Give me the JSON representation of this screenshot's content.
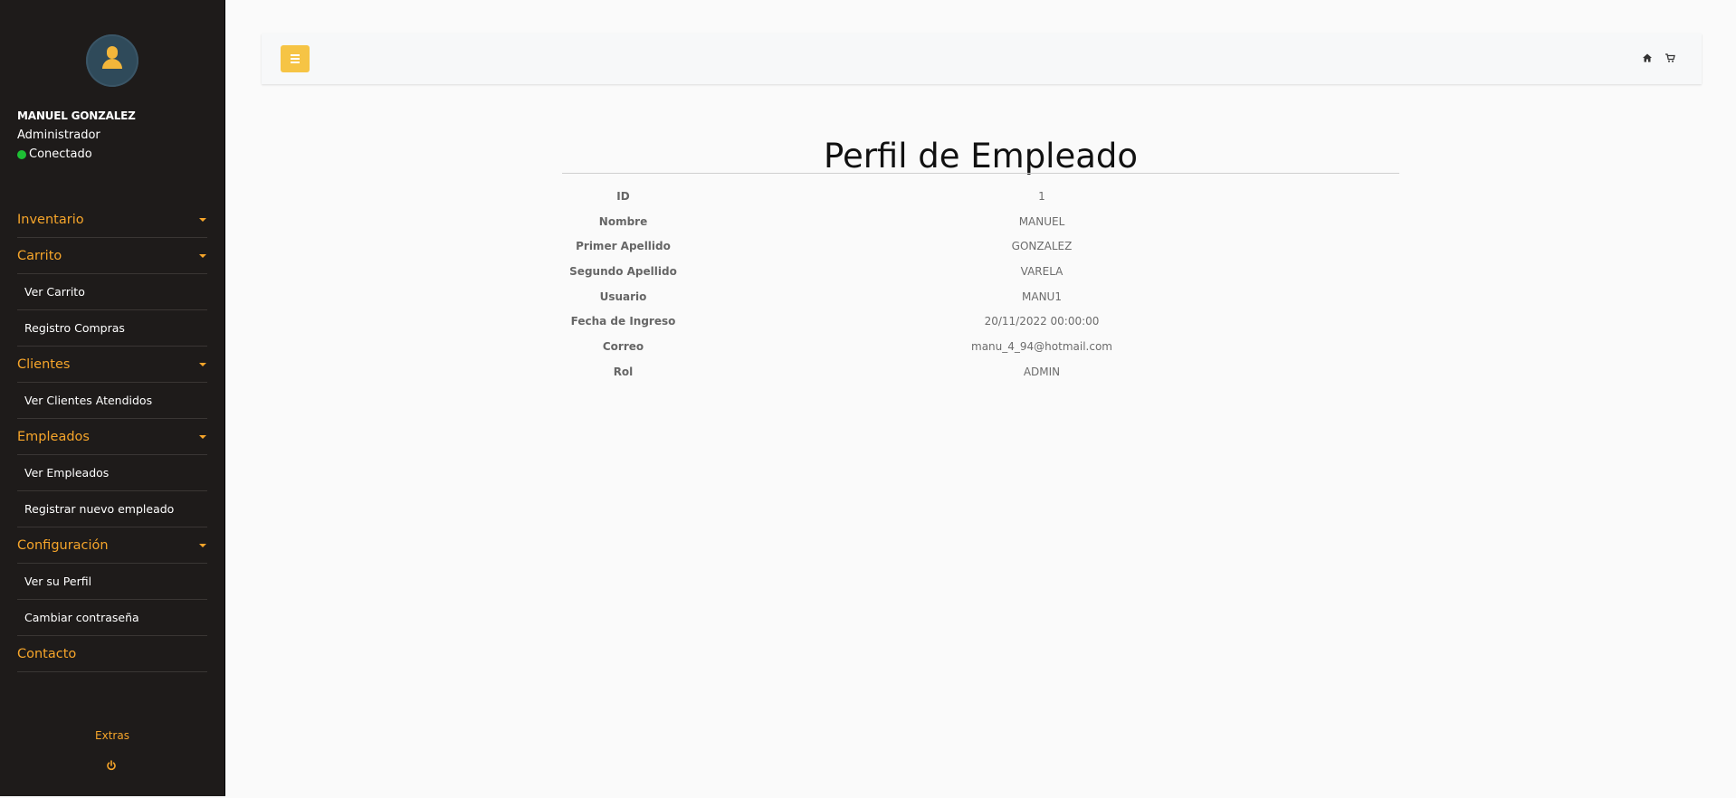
{
  "user": {
    "name": "MANUEL GONZALEZ",
    "role": "Administrador",
    "status": "Conectado"
  },
  "nav": {
    "inventario": "Inventario",
    "carrito": "Carrito",
    "ver_carrito": "Ver Carrito",
    "registro_compras": "Registro Compras",
    "clientes": "Clientes",
    "ver_clientes_atendidos": "Ver Clientes Atendidos",
    "empleados": "Empleados",
    "ver_empleados": "Ver Empleados",
    "registrar_nuevo_empleado": "Registrar nuevo empleado",
    "configuracion": "Configuración",
    "ver_su_perfil": "Ver su Perfil",
    "cambiar_contrasena": "Cambiar contraseña",
    "contacto": "Contacto"
  },
  "footer": {
    "extras": "Extras",
    "power_icon": "power-icon"
  },
  "topbar": {
    "menu_icon": "hamburger-icon",
    "home_icon": "home-icon",
    "cart_icon": "cart-icon"
  },
  "page": {
    "title": "Perfil de Empleado"
  },
  "profile": {
    "rows": [
      {
        "label": "ID",
        "value": "1"
      },
      {
        "label": "Nombre",
        "value": "MANUEL"
      },
      {
        "label": "Primer Apellido",
        "value": "GONZALEZ"
      },
      {
        "label": "Segundo Apellido",
        "value": "VARELA"
      },
      {
        "label": "Usuario",
        "value": "MANU1"
      },
      {
        "label": "Fecha de Ingreso",
        "value": "20/11/2022 00:00:00"
      },
      {
        "label": "Correo",
        "value": "manu_4_94@hotmail.com"
      },
      {
        "label": "Rol",
        "value": "ADMIN"
      }
    ]
  },
  "colors": {
    "sidebar_bg": "#1e1b1a",
    "accent": "#f6a52a",
    "menu_button": "#f6c445",
    "status_online": "#1dbf34",
    "page_bg": "#fafafa"
  }
}
